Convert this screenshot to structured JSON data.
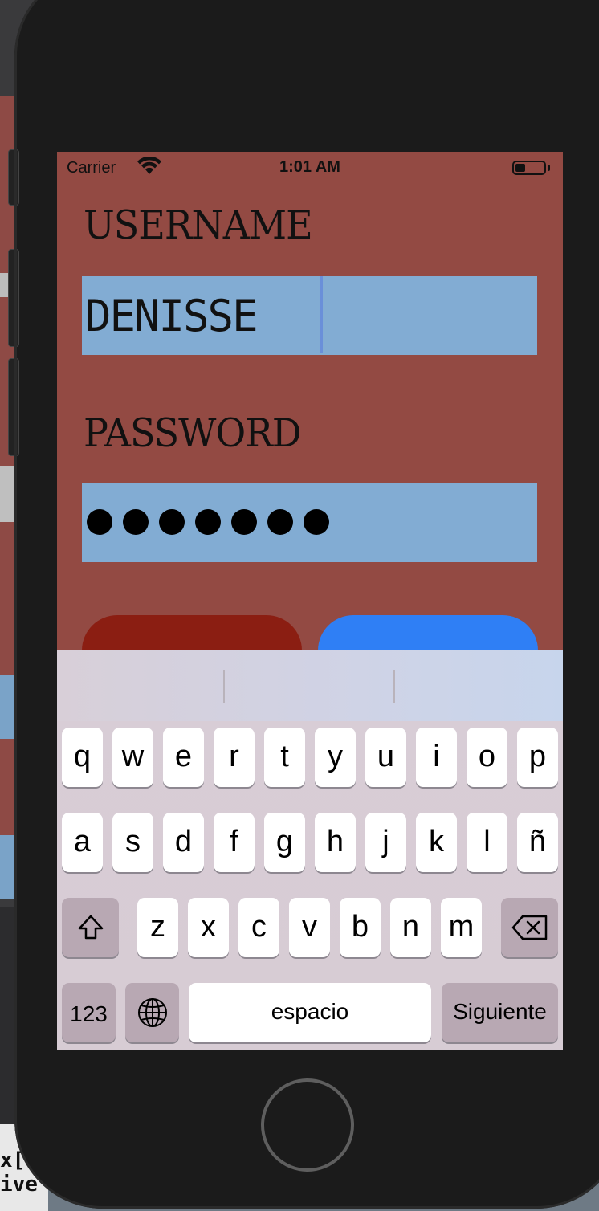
{
  "status_bar": {
    "carrier": "Carrier",
    "time": "1:01 AM"
  },
  "form": {
    "username_label": "USERNAME",
    "username_value": "DENISSE",
    "password_label": "PASSWORD",
    "password_mask": "•••••••",
    "password_length": 7
  },
  "keyboard": {
    "row1": [
      "q",
      "w",
      "e",
      "r",
      "t",
      "y",
      "u",
      "i",
      "o",
      "p"
    ],
    "row2": [
      "a",
      "s",
      "d",
      "f",
      "g",
      "h",
      "j",
      "k",
      "l",
      "ñ"
    ],
    "row3": [
      "z",
      "x",
      "c",
      "v",
      "b",
      "n",
      "m"
    ],
    "numbers_key": "123",
    "space_key": "espacio",
    "return_key": "Siguiente"
  },
  "background": {
    "partial_text": [
      "x[",
      "ive"
    ]
  },
  "colors": {
    "screen_background": "#934a43",
    "field_background": "#82acd3",
    "left_button": "#8b1e12",
    "right_button": "#2f7ff5"
  }
}
